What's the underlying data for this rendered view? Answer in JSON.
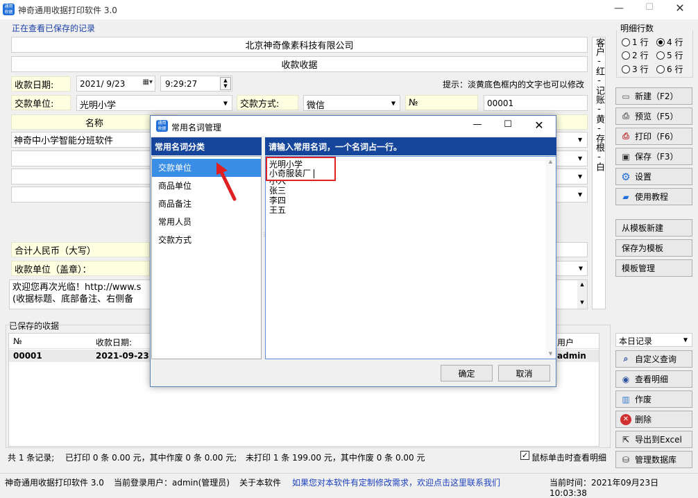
{
  "window": {
    "title": "神奇通用收据打印软件 3.0",
    "app_icon": "通用收据"
  },
  "viewing_label": "正在查看已保存的记录",
  "form": {
    "company": "北京神奇像素科技有限公司",
    "doc_title": "收款收据",
    "date_label": "收款日期:",
    "date_value": "2021/ 9/23",
    "time_value": "9:29:27",
    "hint": "提示：淡黄底色框内的文字也可以修改",
    "payer_label": "交款单位:",
    "payer_value": "光明小学",
    "method_label": "交款方式:",
    "method_value": "微信",
    "no_label": "№",
    "no_value": "00001",
    "name_header": "名称",
    "item1": "神奇中小学智能分班软件",
    "total_label": "合计人民币（大写）",
    "seal_label": "收款单位（盖章）：",
    "note_line1": "欢迎您再次光临！http://www.s",
    "note_line2": "(收据标题、底部备注、右侧备"
  },
  "side_vertical": "客户-红-记账-黄-存根-白",
  "rows_panel": {
    "title": "明细行数",
    "options": [
      "1 行",
      "4 行",
      "2 行",
      "5 行",
      "3 行",
      "6 行"
    ],
    "selected": "4 行"
  },
  "buttons": {
    "new": "新建（F2）",
    "preview": "预览（F5）",
    "print": "打印（F6）",
    "save": "保存（F3）",
    "settings": "设置",
    "tutorial": "使用教程",
    "from_template": "从模板新建",
    "save_template": "保存为模板",
    "template_mgr": "模板管理",
    "custom_query": "自定义查询",
    "view_detail": "查看明细",
    "void": "作废",
    "delete": "删除",
    "export_excel": "导出到Excel",
    "manage_db": "管理数据库"
  },
  "saved": {
    "title": "已保存的收据",
    "filter": "本日记录",
    "columns": [
      "№",
      "收款日期:",
      "用户"
    ],
    "row": {
      "no": "00001",
      "date": "2021-09-23",
      "user": "admin"
    }
  },
  "summary": {
    "total": "共 1 条记录;",
    "printed": "已打印 0 条 0.00 元，其中作废 0 条 0.00 元;",
    "unprinted": "未打印 1 条 199.00 元，其中作废 0 条 0.00 元",
    "checkbox_label": "鼠标单击时查看明细"
  },
  "status": {
    "app": "神奇通用收据打印软件 3.0",
    "user": "当前登录用户：admin(管理员)",
    "about": "关于本软件",
    "link": "如果您对本软件有定制修改需求，欢迎点击这里联系我们",
    "time": "当前时间：2021年09月23日 10:03:38"
  },
  "dialog": {
    "title": "常用名词管理",
    "left_header": "常用名词分类",
    "right_header": "请输入常用名词，一个名词占一行。",
    "categories": [
      "交款单位",
      "商品单位",
      "商品备注",
      "常用人员",
      "交款方式"
    ],
    "selected_category": "交款单位",
    "terms": [
      "光明小学",
      "小奇服装厂",
      "小入",
      "张三",
      "李四",
      "王五"
    ],
    "ok": "确定",
    "cancel": "取消"
  },
  "colors": {
    "accent": "#15469b",
    "highlight": "#3a8ee6",
    "annotation": "#e02020",
    "yellow_field": "#ffffe1"
  }
}
